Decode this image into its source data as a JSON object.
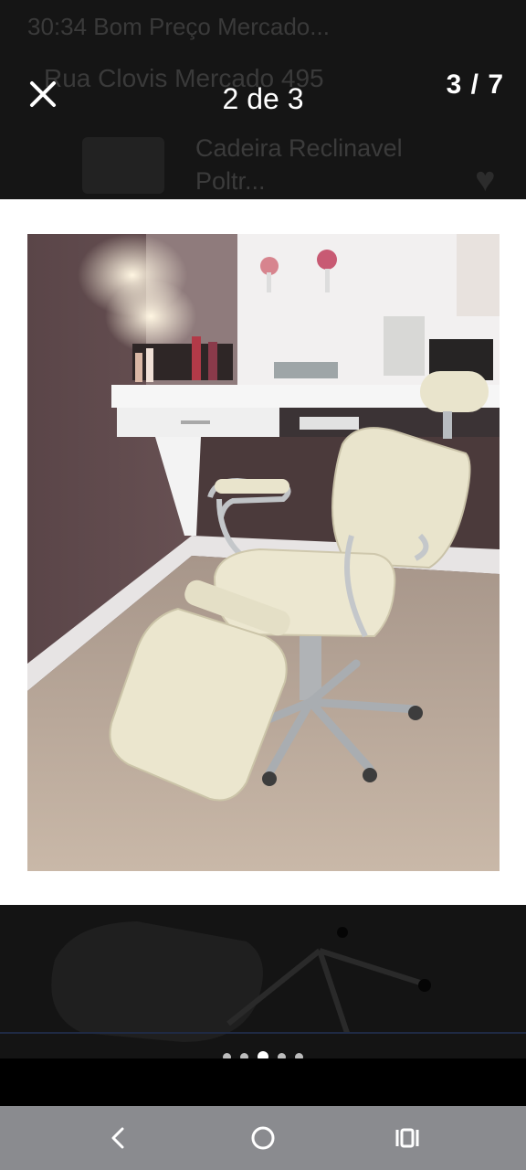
{
  "background_app": {
    "status_text": "30:34 Bom Preço Mercado...",
    "address": "Rua Clovis Mercado 495",
    "listing_title": "Cadeira Reclinavel Poltr..."
  },
  "viewer": {
    "page_indicator": "2 de 3",
    "image_counter": "3 / 7",
    "close_icon": "close-icon"
  },
  "carousel": {
    "dot_count": 5,
    "active_index": 2
  },
  "nav_bar": {
    "back_icon": "back-chevron-icon",
    "home_icon": "home-circle-icon",
    "recents_icon": "recents-icon"
  },
  "colors": {
    "overlay": "#000000",
    "card": "#ffffff",
    "nav_bar": "#8a8b8f",
    "chair": "#e9e4cc"
  }
}
